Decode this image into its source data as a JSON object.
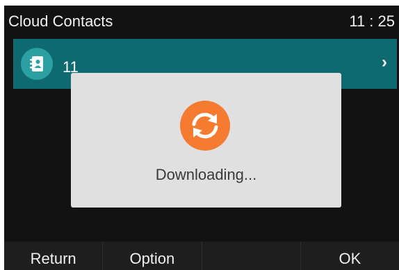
{
  "header": {
    "title": "Cloud Contacts",
    "time": "11 : 25"
  },
  "contact": {
    "name": "11",
    "icon": "contact-book-icon"
  },
  "dialog": {
    "message": "Downloading...",
    "icon": "sync-icon"
  },
  "softkeys": [
    {
      "label": "Return"
    },
    {
      "label": "Option"
    },
    {
      "label": ""
    },
    {
      "label": "OK"
    }
  ],
  "colors": {
    "background": "#121212",
    "selected_row": "#0e6a6e",
    "dialog": "#e0e0e0",
    "sync_icon": "#f47b30"
  }
}
